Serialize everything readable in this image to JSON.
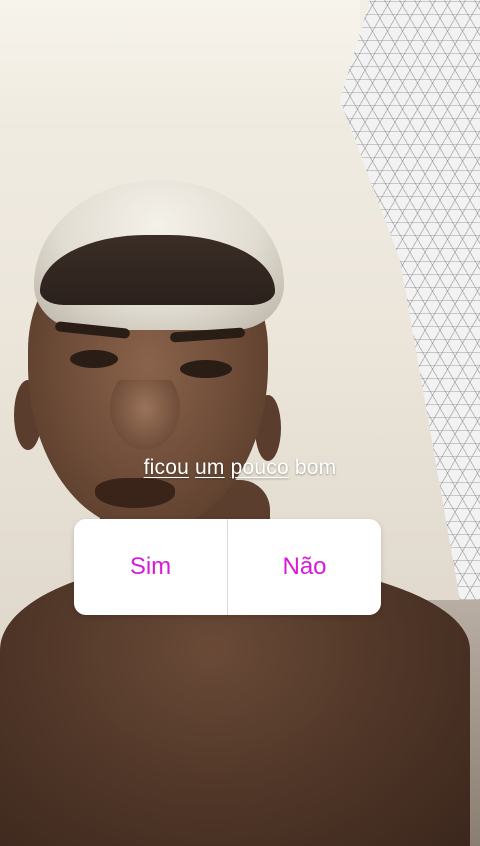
{
  "caption": {
    "word1": "ficou",
    "word2": "um",
    "word3": "pouco",
    "word4": "bom"
  },
  "poll": {
    "option_yes": "Sim",
    "option_no": "Não",
    "accent_color": "#d81ad8"
  }
}
